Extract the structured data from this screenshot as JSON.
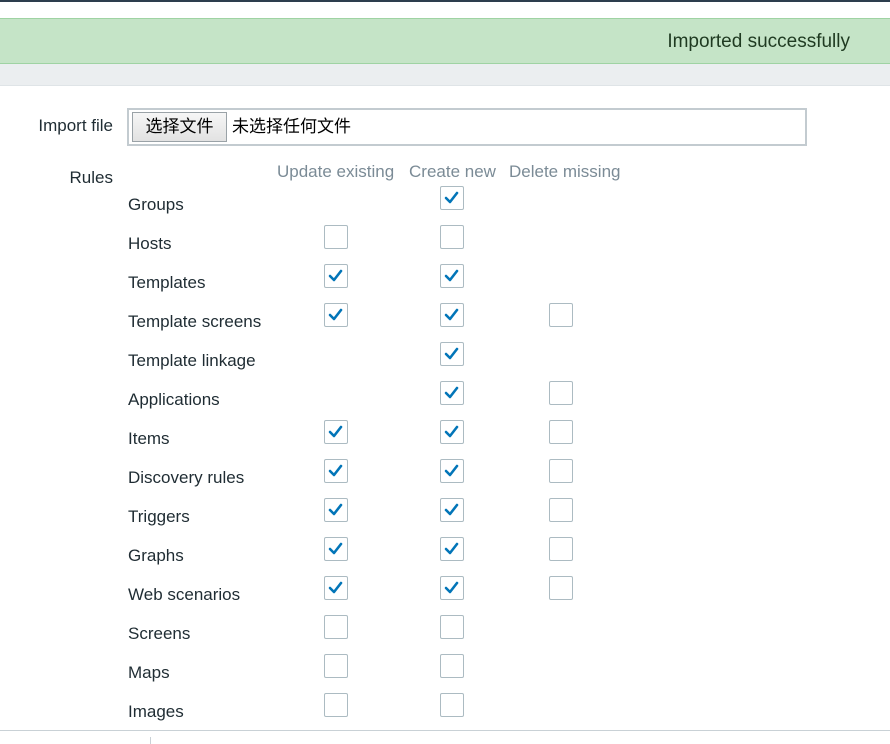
{
  "message": {
    "text": "Imported successfully",
    "color": "#c5e4c7"
  },
  "form": {
    "import_file_label": "Import file",
    "file_button_label": "选择文件",
    "file_status": "未选择任何文件",
    "rules_label": "Rules"
  },
  "columns": {
    "update": "Update existing",
    "create": "Create new",
    "delete": "Delete missing"
  },
  "accent_color": "#0275b8",
  "rules": [
    {
      "label": "Groups",
      "update": null,
      "create": true,
      "delete": null
    },
    {
      "label": "Hosts",
      "update": false,
      "create": false,
      "delete": null
    },
    {
      "label": "Templates",
      "update": true,
      "create": true,
      "delete": null
    },
    {
      "label": "Template screens",
      "update": true,
      "create": true,
      "delete": false
    },
    {
      "label": "Template linkage",
      "update": null,
      "create": true,
      "delete": null
    },
    {
      "label": "Applications",
      "update": null,
      "create": true,
      "delete": false
    },
    {
      "label": "Items",
      "update": true,
      "create": true,
      "delete": false
    },
    {
      "label": "Discovery rules",
      "update": true,
      "create": true,
      "delete": false
    },
    {
      "label": "Triggers",
      "update": true,
      "create": true,
      "delete": false
    },
    {
      "label": "Graphs",
      "update": true,
      "create": true,
      "delete": false
    },
    {
      "label": "Web scenarios",
      "update": true,
      "create": true,
      "delete": false
    },
    {
      "label": "Screens",
      "update": false,
      "create": false,
      "delete": null
    },
    {
      "label": "Maps",
      "update": false,
      "create": false,
      "delete": null
    },
    {
      "label": "Images",
      "update": false,
      "create": false,
      "delete": null
    }
  ]
}
